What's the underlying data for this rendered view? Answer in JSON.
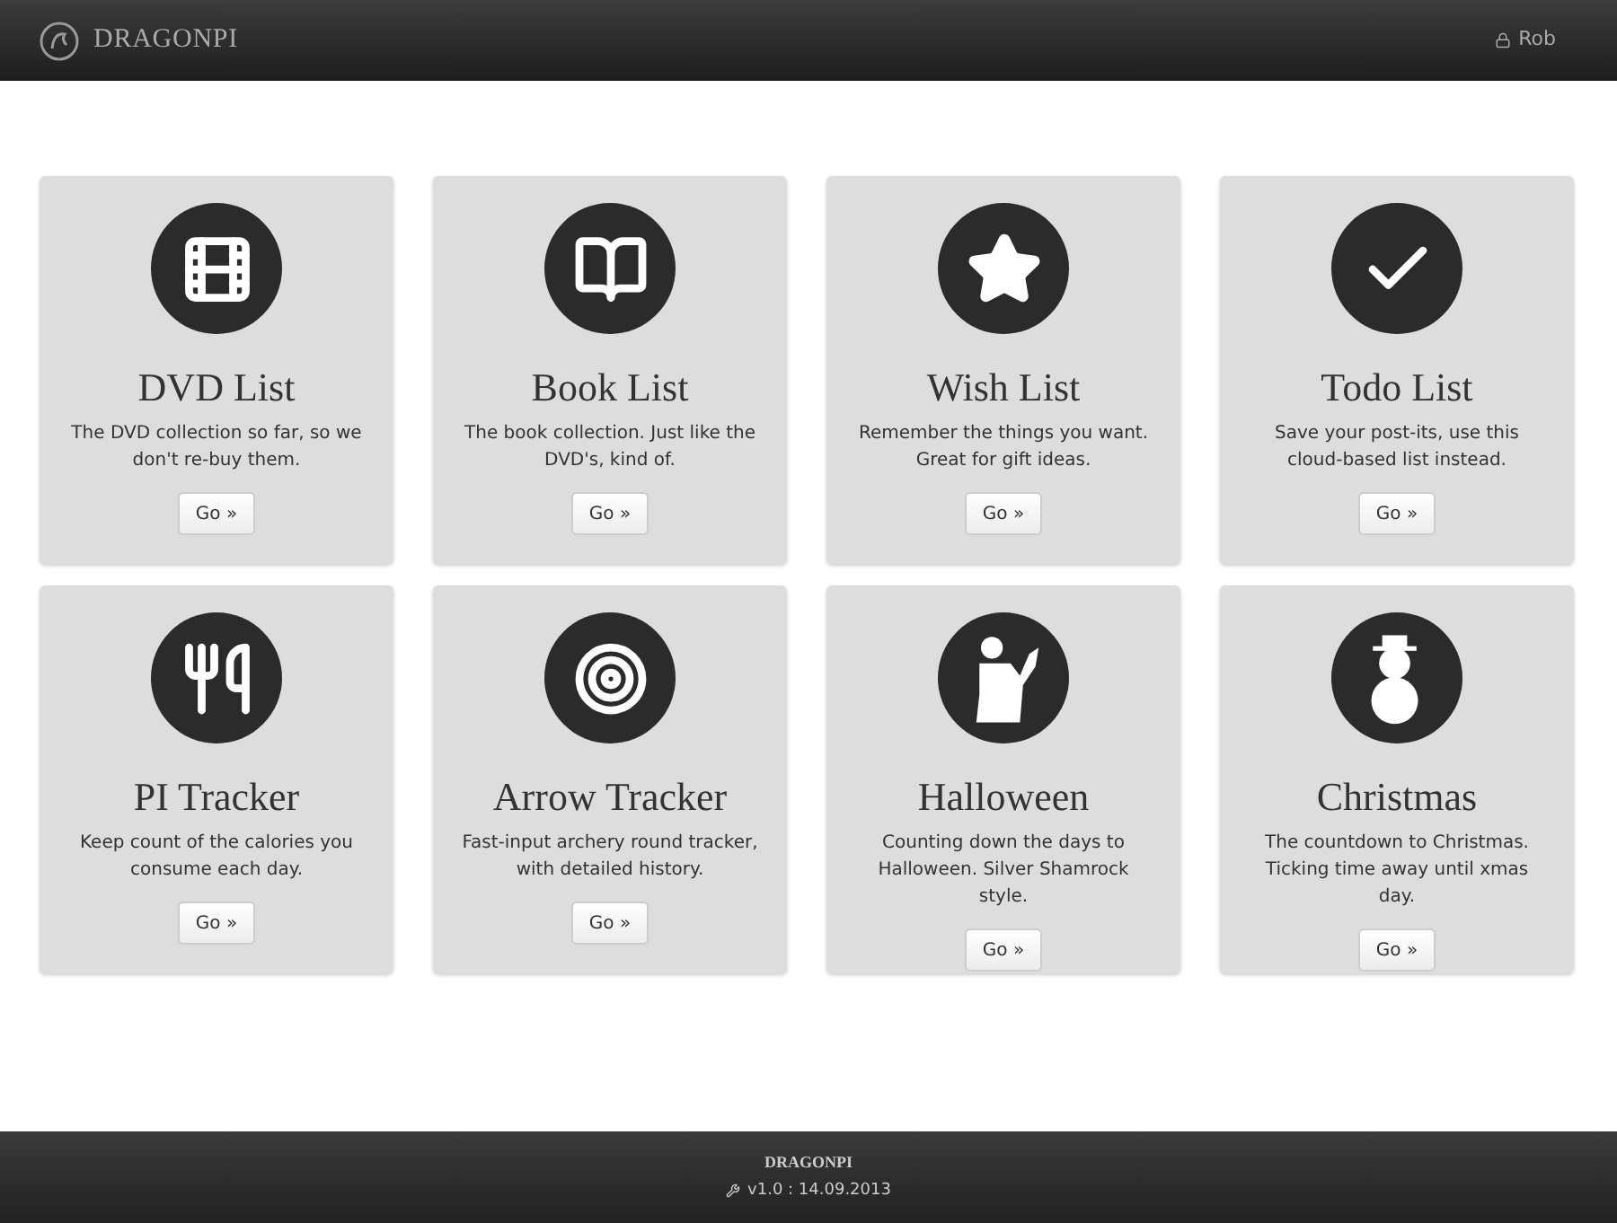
{
  "header": {
    "brand": "DRAGONPI",
    "user": "Rob"
  },
  "cards": [
    {
      "title": "DVD List",
      "description": "The DVD collection so far, so we don't re-buy them.",
      "button": "Go »"
    },
    {
      "title": "Book List",
      "description": "The book collection. Just like the DVD's, kind of.",
      "button": "Go »"
    },
    {
      "title": "Wish List",
      "description": "Remember the things you want. Great for gift ideas.",
      "button": "Go »"
    },
    {
      "title": "Todo List",
      "description": "Save your post-its, use this cloud-based list instead.",
      "button": "Go »"
    },
    {
      "title": "PI Tracker",
      "description": "Keep count of the calories you consume each day.",
      "button": "Go »"
    },
    {
      "title": "Arrow Tracker",
      "description": "Fast-input archery round tracker, with detailed history.",
      "button": "Go »"
    },
    {
      "title": "Halloween",
      "description": "Counting down the days to Halloween. Silver Shamrock style.",
      "button": "Go »"
    },
    {
      "title": "Christmas",
      "description": "The countdown to Christmas. Ticking time away until xmas day.",
      "button": "Go »"
    }
  ],
  "footer": {
    "brand": "DRAGONPI",
    "version": "v1.0 : 14.09.2013"
  }
}
